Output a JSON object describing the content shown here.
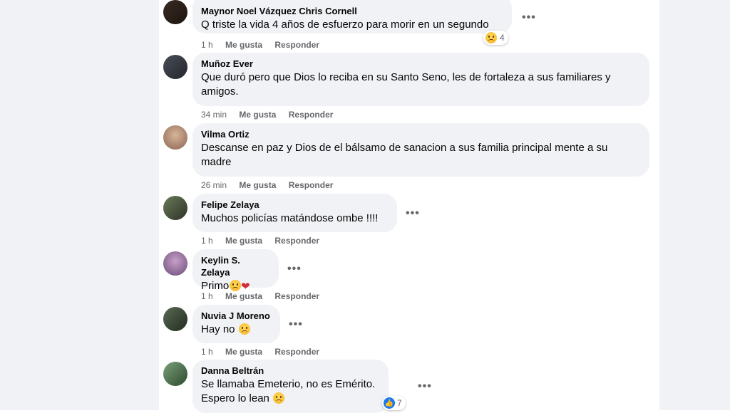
{
  "ui": {
    "more_glyph": "•••",
    "like_glyph": "👍"
  },
  "comments": [
    {
      "author": "Maynor Noel Vázquez Chris Cornell",
      "lines": [
        "Q triste la vida 4 años de esfuerzo para morir en un segundo"
      ],
      "time": "1 h",
      "like": "Me gusta",
      "reply": "Responder",
      "reaction_count": "4"
    },
    {
      "author": "Muñoz Ever",
      "lines": [
        "Que duró pero que Dios lo reciba en su Santo Seno, les de fortaleza a sus familiares y",
        "amigos."
      ],
      "time": "34 min",
      "like": "Me gusta",
      "reply": "Responder"
    },
    {
      "author": "Vilma Ortiz",
      "lines": [
        "Descanse en paz y Dios de el bálsamo de sanacion a sus familia principal mente a su",
        "madre"
      ],
      "time": "26 min",
      "like": "Me gusta",
      "reply": "Responder"
    },
    {
      "author": "Felipe Zelaya",
      "lines": [
        "Muchos policías matándose ombe !!!!"
      ],
      "time": "1 h",
      "like": "Me gusta",
      "reply": "Responder"
    },
    {
      "author": "Keylin S. Zelaya",
      "lines": [
        "Primo"
      ],
      "time": "1 h",
      "like": "Me gusta",
      "reply": "Responder"
    },
    {
      "author": "Nuvia J Moreno",
      "lines": [
        "Hay no"
      ],
      "time": "1 h",
      "like": "Me gusta",
      "reply": "Responder"
    },
    {
      "author": "Danna Beltrán",
      "lines": [
        "Se llamaba Emeterio, no es Emérito.",
        "Espero lo lean"
      ],
      "time": "",
      "like": "",
      "reply": "",
      "reaction_count": "7"
    }
  ]
}
